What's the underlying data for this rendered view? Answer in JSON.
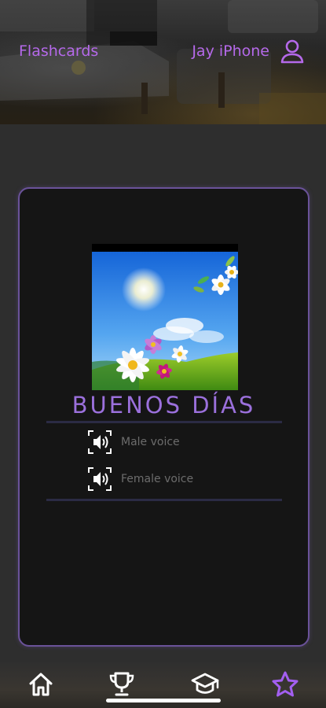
{
  "header": {
    "app_title": "Flashcards",
    "user_name": "Jay iPhone",
    "user_icon": "person-icon",
    "accent_color": "#b569ea"
  },
  "card": {
    "image": "flowers-sunny-meadow-illustration",
    "word": "BUENOS DÍAS",
    "word_color": "#9b70dc",
    "voices": [
      {
        "label": "Male voice",
        "icon": "speaker-icon"
      },
      {
        "label": "Female voice",
        "icon": "speaker-icon"
      }
    ]
  },
  "bottom_nav": {
    "items": [
      {
        "icon": "home-icon"
      },
      {
        "icon": "trophy-icon"
      },
      {
        "icon": "graduation-cap-icon"
      },
      {
        "icon": "star-icon",
        "active": true
      }
    ],
    "active_color": "#a35ff0"
  }
}
